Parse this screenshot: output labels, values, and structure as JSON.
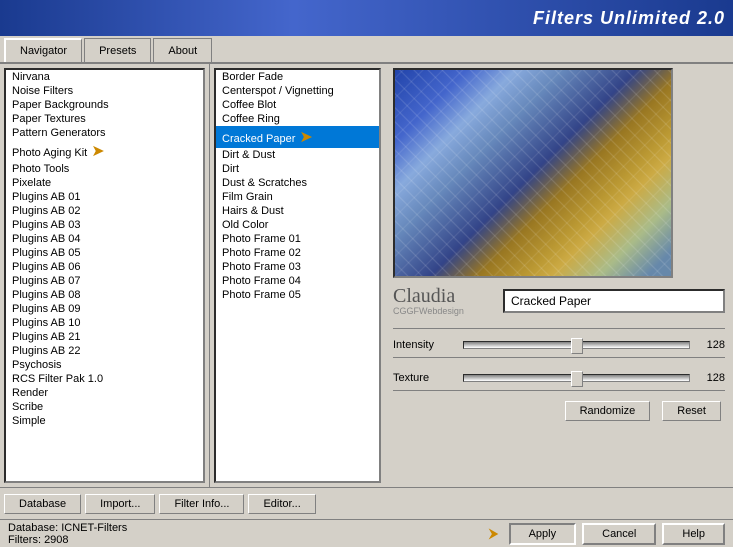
{
  "titleBar": {
    "title": "Filters Unlimited 2.0"
  },
  "tabs": [
    {
      "label": "Navigator",
      "active": true
    },
    {
      "label": "Presets",
      "active": false
    },
    {
      "label": "About",
      "active": false
    }
  ],
  "leftList": {
    "items": [
      "Nirvana",
      "Noise Filters",
      "Paper Backgrounds",
      "Paper Textures",
      "Pattern Generators",
      "Photo Aging Kit",
      "Photo Tools",
      "Pixelate",
      "Plugins AB 01",
      "Plugins AB 02",
      "Plugins AB 03",
      "Plugins AB 04",
      "Plugins AB 05",
      "Plugins AB 06",
      "Plugins AB 07",
      "Plugins AB 08",
      "Plugins AB 09",
      "Plugins AB 10",
      "Plugins AB 21",
      "Plugins AB 22",
      "Psychosis",
      "RCS Filter Pak 1.0",
      "Render",
      "Scribe",
      "Simple"
    ],
    "selectedIndex": -1
  },
  "middleList": {
    "items": [
      "Border Fade",
      "Centerspot / Vignetting",
      "Coffee Blot",
      "Coffee Ring",
      "Cracked Paper",
      "Dirt & Dust",
      "Dirt",
      "Dust & Scratches",
      "Film Grain",
      "Hairs & Dust",
      "Old Color",
      "Photo Frame 01",
      "Photo Frame 02",
      "Photo Frame 03",
      "Photo Frame 04",
      "Photo Frame 05"
    ],
    "selectedIndex": 4
  },
  "rightPanel": {
    "filterName": "Cracked Paper",
    "signature": "Claudia",
    "signatureSub": "CGGFWebdesign",
    "intensityLabel": "Intensity",
    "intensityValue": "128",
    "textureLabel": "Texture",
    "textureValue": "128",
    "randomizeLabel": "Randomize",
    "resetLabel": "Reset"
  },
  "toolbar": {
    "databaseLabel": "Database",
    "importLabel": "Import...",
    "filterInfoLabel": "Filter Info...",
    "editorLabel": "Editor..."
  },
  "statusBar": {
    "databaseLabel": "Database:",
    "databaseValue": "ICNET-Filters",
    "filtersLabel": "Filters:",
    "filtersValue": "2908",
    "applyLabel": "Apply",
    "cancelLabel": "Cancel",
    "helpLabel": "Help"
  }
}
